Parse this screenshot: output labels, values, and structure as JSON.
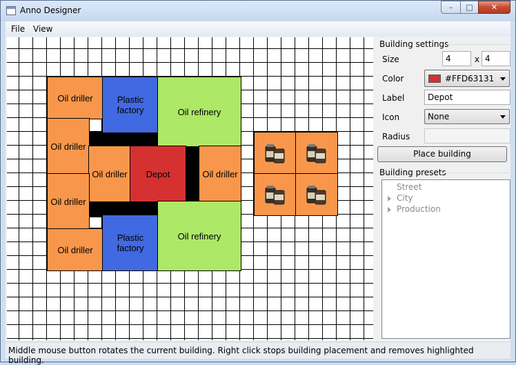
{
  "window": {
    "title": "Anno Designer",
    "minimize": "–",
    "maximize": "□",
    "close": "✕"
  },
  "menu": {
    "file": "File",
    "view": "View"
  },
  "buildings": {
    "oil_driller": "Oil driller",
    "plastic_factory": "Plastic factory",
    "oil_refinery": "Oil refinery",
    "depot": "Depot"
  },
  "colors": {
    "oil_driller": "#F8974B",
    "plastic_factory": "#4169E1",
    "oil_refinery": "#ADE867",
    "depot": "#D63131",
    "road": "#000000"
  },
  "settings": {
    "title": "Building settings",
    "size_label": "Size",
    "size_width": "4",
    "size_x": "x",
    "size_height": "4",
    "color_label": "Color",
    "color_value": "#FFD63131",
    "label_label": "Label",
    "label_value": "Depot",
    "icon_label": "Icon",
    "icon_value": "None",
    "radius_label": "Radius",
    "radius_value": "",
    "place_button": "Place building"
  },
  "presets": {
    "title": "Building presets",
    "items": [
      "Street",
      "City",
      "Production"
    ]
  },
  "status": "Middle mouse button rotates the current building.  Right click stops building placement and removes highlighted building."
}
